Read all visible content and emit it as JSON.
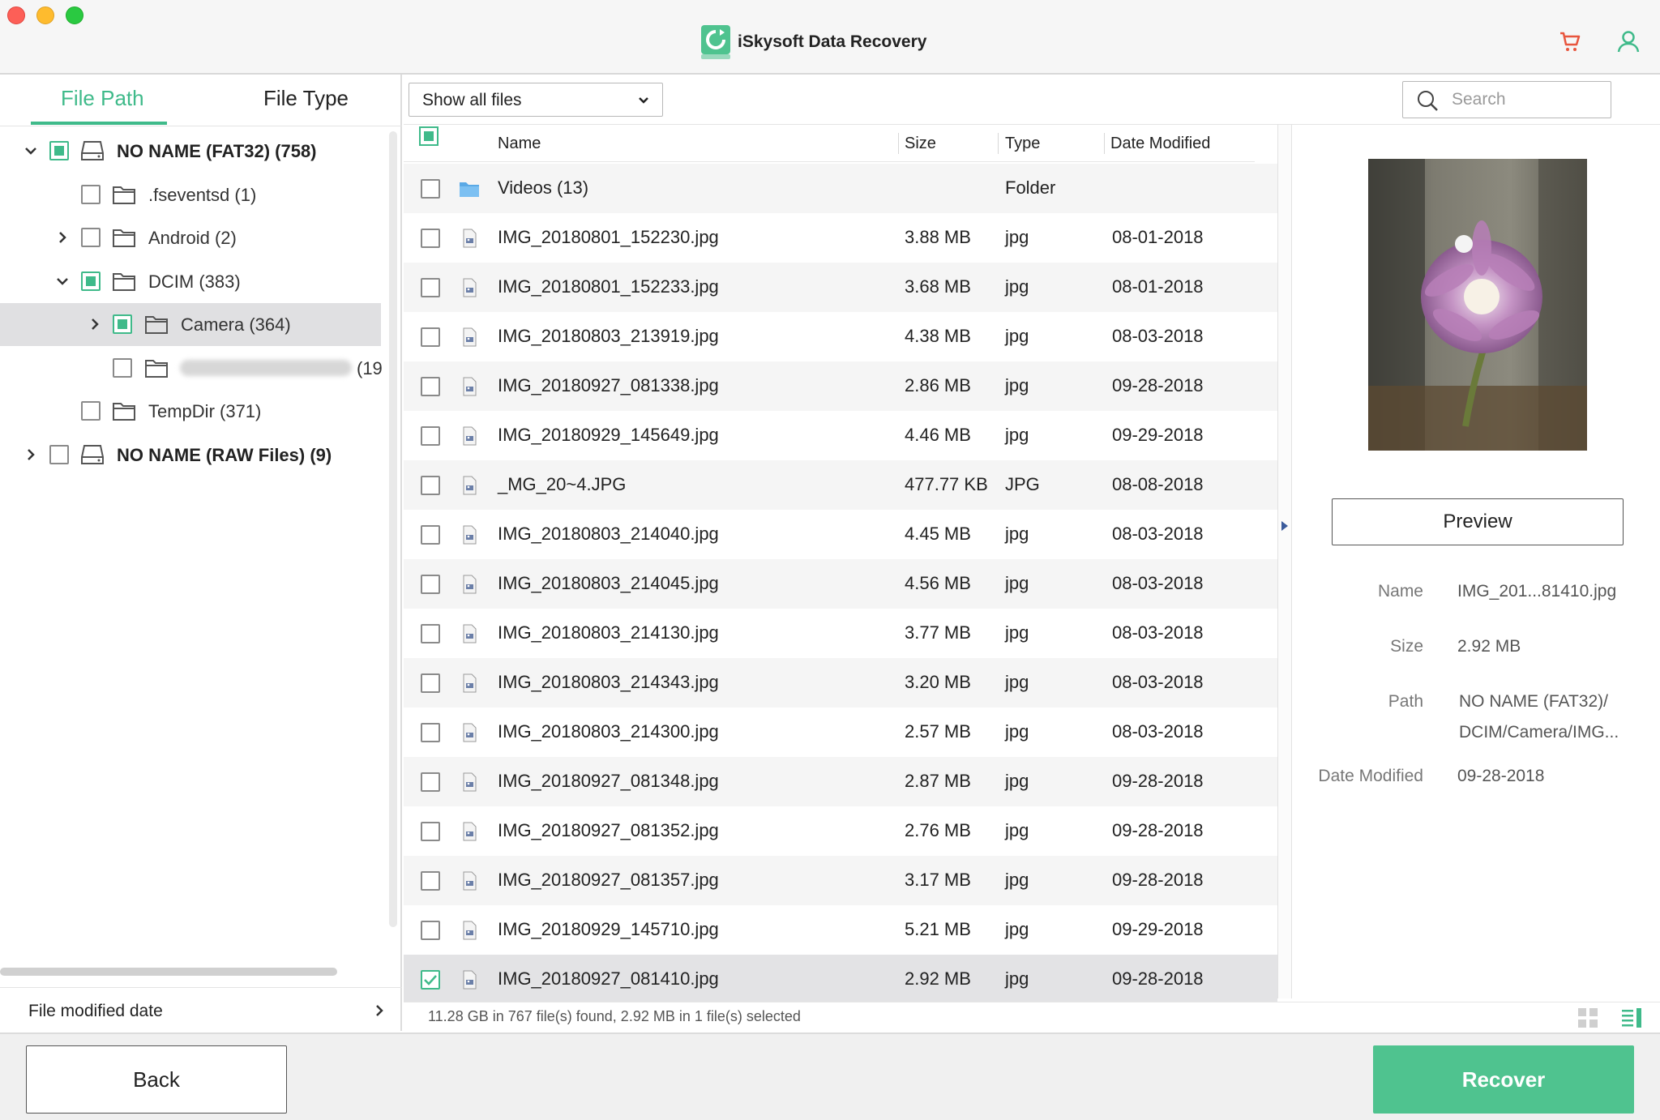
{
  "window": {
    "title": "iSkysoft Data Recovery"
  },
  "colors": {
    "accent": "#3fba8a",
    "recover_button": "#4fc38f",
    "selected_row": "#e3e3e5"
  },
  "left_panel": {
    "tabs": [
      {
        "label": "File Path",
        "active": true
      },
      {
        "label": "File Type",
        "active": false
      }
    ],
    "tree": [
      {
        "label": "NO NAME (FAT32) (758)",
        "checked": "partial",
        "expanded": true,
        "icon": "drive-icon"
      },
      {
        "label": ".fseventsd (1)",
        "checked": "none",
        "icon": "folder-icon"
      },
      {
        "label": "Android (2)",
        "checked": "none",
        "expanded": false,
        "icon": "folder-icon"
      },
      {
        "label": "DCIM (383)",
        "checked": "partial",
        "expanded": true,
        "icon": "folder-icon"
      },
      {
        "label": "Camera (364)",
        "checked": "partial",
        "expanded": false,
        "selected": true,
        "icon": "folder-icon"
      },
      {
        "label": "(19",
        "checked": "none",
        "icon": "folder-icon"
      },
      {
        "label": "TempDir (371)",
        "checked": "none",
        "icon": "folder-icon"
      },
      {
        "label": "NO NAME (RAW Files) (9)",
        "checked": "none",
        "expanded": false,
        "icon": "drive-icon"
      }
    ],
    "date_filter_label": "File modified date"
  },
  "file_list": {
    "filter_value": "Show all files",
    "search_placeholder": "Search",
    "columns": [
      "Name",
      "Size",
      "Type",
      "Date Modified"
    ],
    "rows": [
      {
        "name": "Videos (13)",
        "size": "",
        "type": "Folder",
        "date": "",
        "icon": "folder-icon"
      },
      {
        "name": "IMG_20180801_152230.jpg",
        "size": "3.88 MB",
        "type": "jpg",
        "date": "08-01-2018",
        "icon": "image-file-icon"
      },
      {
        "name": "IMG_20180801_152233.jpg",
        "size": "3.68 MB",
        "type": "jpg",
        "date": "08-01-2018",
        "icon": "image-file-icon"
      },
      {
        "name": "IMG_20180803_213919.jpg",
        "size": "4.38 MB",
        "type": "jpg",
        "date": "08-03-2018",
        "icon": "image-file-icon"
      },
      {
        "name": "IMG_20180927_081338.jpg",
        "size": "2.86 MB",
        "type": "jpg",
        "date": "09-28-2018",
        "icon": "image-file-icon"
      },
      {
        "name": "IMG_20180929_145649.jpg",
        "size": "4.46 MB",
        "type": "jpg",
        "date": "09-29-2018",
        "icon": "image-file-icon"
      },
      {
        "name": "_MG_20~4.JPG",
        "size": "477.77 KB",
        "type": "JPG",
        "date": "08-08-2018",
        "icon": "image-file-icon"
      },
      {
        "name": "IMG_20180803_214040.jpg",
        "size": "4.45 MB",
        "type": "jpg",
        "date": "08-03-2018",
        "icon": "image-file-icon"
      },
      {
        "name": "IMG_20180803_214045.jpg",
        "size": "4.56 MB",
        "type": "jpg",
        "date": "08-03-2018",
        "icon": "image-file-icon"
      },
      {
        "name": "IMG_20180803_214130.jpg",
        "size": "3.77 MB",
        "type": "jpg",
        "date": "08-03-2018",
        "icon": "image-file-icon"
      },
      {
        "name": "IMG_20180803_214343.jpg",
        "size": "3.20 MB",
        "type": "jpg",
        "date": "08-03-2018",
        "icon": "image-file-icon"
      },
      {
        "name": "IMG_20180803_214300.jpg",
        "size": "2.57 MB",
        "type": "jpg",
        "date": "08-03-2018",
        "icon": "image-file-icon"
      },
      {
        "name": "IMG_20180927_081348.jpg",
        "size": "2.87 MB",
        "type": "jpg",
        "date": "09-28-2018",
        "icon": "image-file-icon"
      },
      {
        "name": "IMG_20180927_081352.jpg",
        "size": "2.76 MB",
        "type": "jpg",
        "date": "09-28-2018",
        "icon": "image-file-icon"
      },
      {
        "name": "IMG_20180927_081357.jpg",
        "size": "3.17 MB",
        "type": "jpg",
        "date": "09-28-2018",
        "icon": "image-file-icon"
      },
      {
        "name": "IMG_20180929_145710.jpg",
        "size": "5.21 MB",
        "type": "jpg",
        "date": "09-29-2018",
        "icon": "image-file-icon"
      },
      {
        "name": "IMG_20180927_081410.jpg",
        "size": "2.92 MB",
        "type": "jpg",
        "date": "09-28-2018",
        "icon": "image-file-icon",
        "selected": true
      }
    ],
    "status_text": "11.28 GB in 767 file(s) found, 2.92 MB in 1 file(s) selected"
  },
  "preview_panel": {
    "button_label": "Preview",
    "details": [
      {
        "label": "Name",
        "value": "IMG_201...81410.jpg"
      },
      {
        "label": "Size",
        "value": "2.92 MB"
      },
      {
        "label": "Path",
        "value": "NO NAME (FAT32)/",
        "value2": "DCIM/Camera/IMG..."
      },
      {
        "label": "Date Modified",
        "value": "09-28-2018"
      }
    ]
  },
  "bottom_bar": {
    "back_label": "Back",
    "recover_label": "Recover"
  }
}
